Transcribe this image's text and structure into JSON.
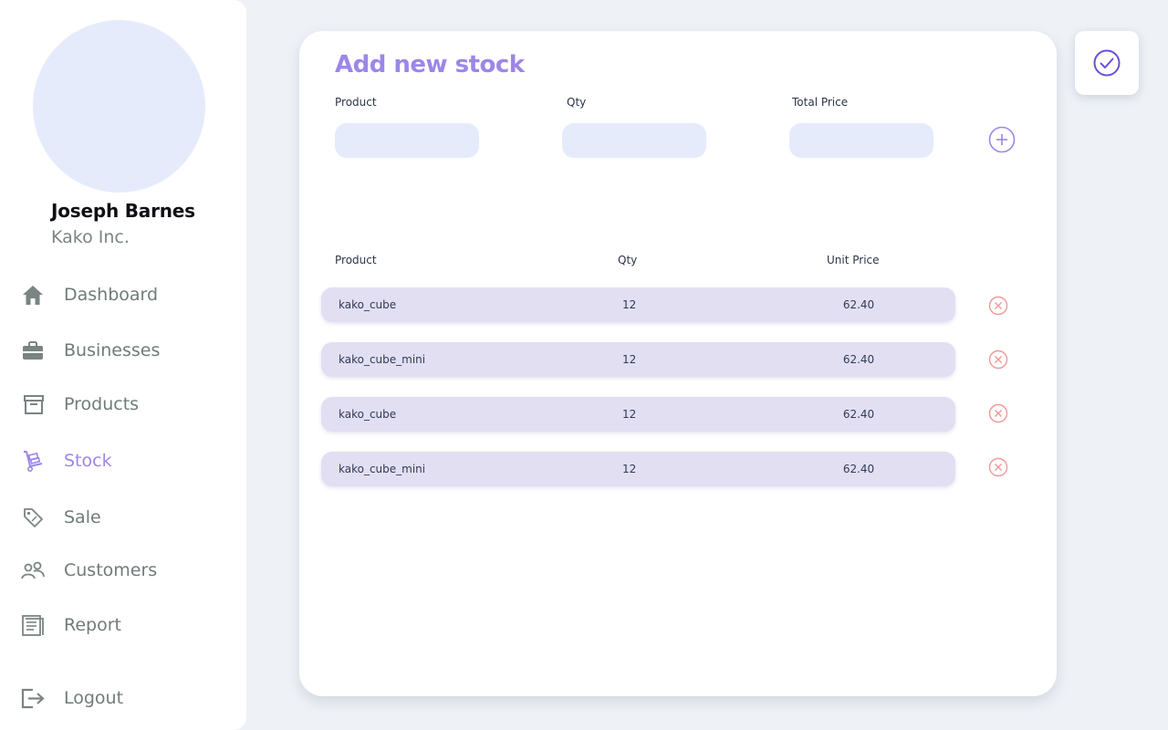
{
  "colors": {
    "accent": "#9d86e8",
    "icon_accent": "#6b4fd8",
    "input_bg": "#e6ebfc",
    "row_bg": "#e2dff3",
    "remove_icon": "#ec9a95",
    "page_bg": "#eef1f6"
  },
  "user": {
    "name": "Joseph Barnes",
    "company": "Kako Inc."
  },
  "sidebar": {
    "items": [
      {
        "label": "Dashboard",
        "icon": "home-icon"
      },
      {
        "label": "Businesses",
        "icon": "briefcase-icon"
      },
      {
        "label": "Products",
        "icon": "archive-box-icon"
      },
      {
        "label": "Stock",
        "icon": "hand-truck-icon",
        "active": true
      },
      {
        "label": "Sale",
        "icon": "price-tag-icon"
      },
      {
        "label": "Customers",
        "icon": "users-icon"
      },
      {
        "label": "Report",
        "icon": "report-icon"
      }
    ],
    "logout": {
      "label": "Logout",
      "icon": "logout-icon"
    }
  },
  "form": {
    "title": "Add new stock",
    "product_label": "Product",
    "qty_label": "Qty",
    "total_price_label": "Total Price",
    "product_value": "",
    "qty_value": "",
    "total_price_value": "",
    "add_icon": "plus-circle-icon"
  },
  "table": {
    "headers": {
      "product": "Product",
      "qty": "Qty",
      "unit_price": "Unit Price"
    },
    "rows": [
      {
        "product": "kako_cube",
        "qty": "12",
        "unit_price": "62.40"
      },
      {
        "product": "kako_cube_mini",
        "qty": "12",
        "unit_price": "62.40"
      },
      {
        "product": "kako_cube",
        "qty": "12",
        "unit_price": "62.40"
      },
      {
        "product": "kako_cube_mini",
        "qty": "12",
        "unit_price": "62.40"
      }
    ],
    "remove_icon": "close-circle-icon"
  },
  "confirm_icon": "check-circle-icon"
}
